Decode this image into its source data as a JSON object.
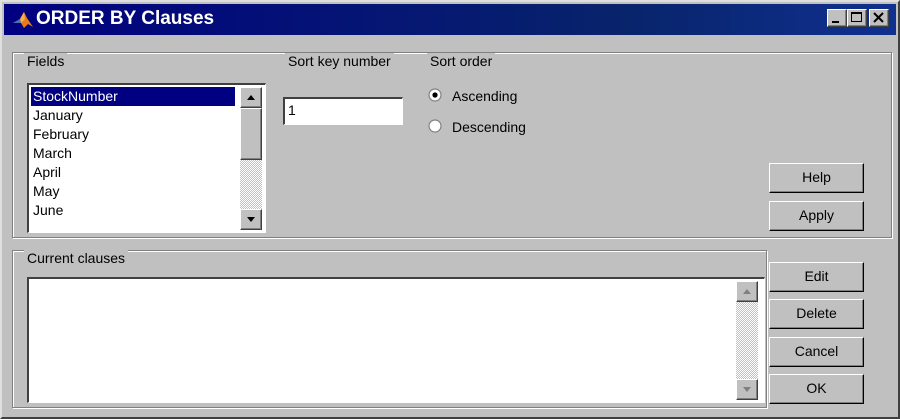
{
  "window": {
    "title": "ORDER BY Clauses",
    "controls": {
      "minimize": "minimize",
      "maximize": "maximize",
      "close": "close"
    }
  },
  "fields": {
    "label": "Fields",
    "items": [
      "StockNumber",
      "January",
      "February",
      "March",
      "April",
      "May",
      "June"
    ],
    "selected": "StockNumber"
  },
  "sort_key": {
    "label": "Sort key number",
    "value": "1"
  },
  "sort_order": {
    "label": "Sort order",
    "options": [
      "Ascending",
      "Descending"
    ],
    "selected": "Ascending"
  },
  "buttons": {
    "help": "Help",
    "apply": "Apply",
    "edit": "Edit",
    "delete": "Delete",
    "cancel": "Cancel",
    "ok": "OK"
  },
  "current_clauses": {
    "label": "Current clauses",
    "items": []
  },
  "icons": {
    "app": "matlab-logo-icon",
    "scroll_up": "arrow-up-icon",
    "scroll_down": "arrow-down-icon"
  },
  "colors": {
    "title_bar": "#000080",
    "selection": "#000080",
    "face": "#c0c0c0"
  }
}
